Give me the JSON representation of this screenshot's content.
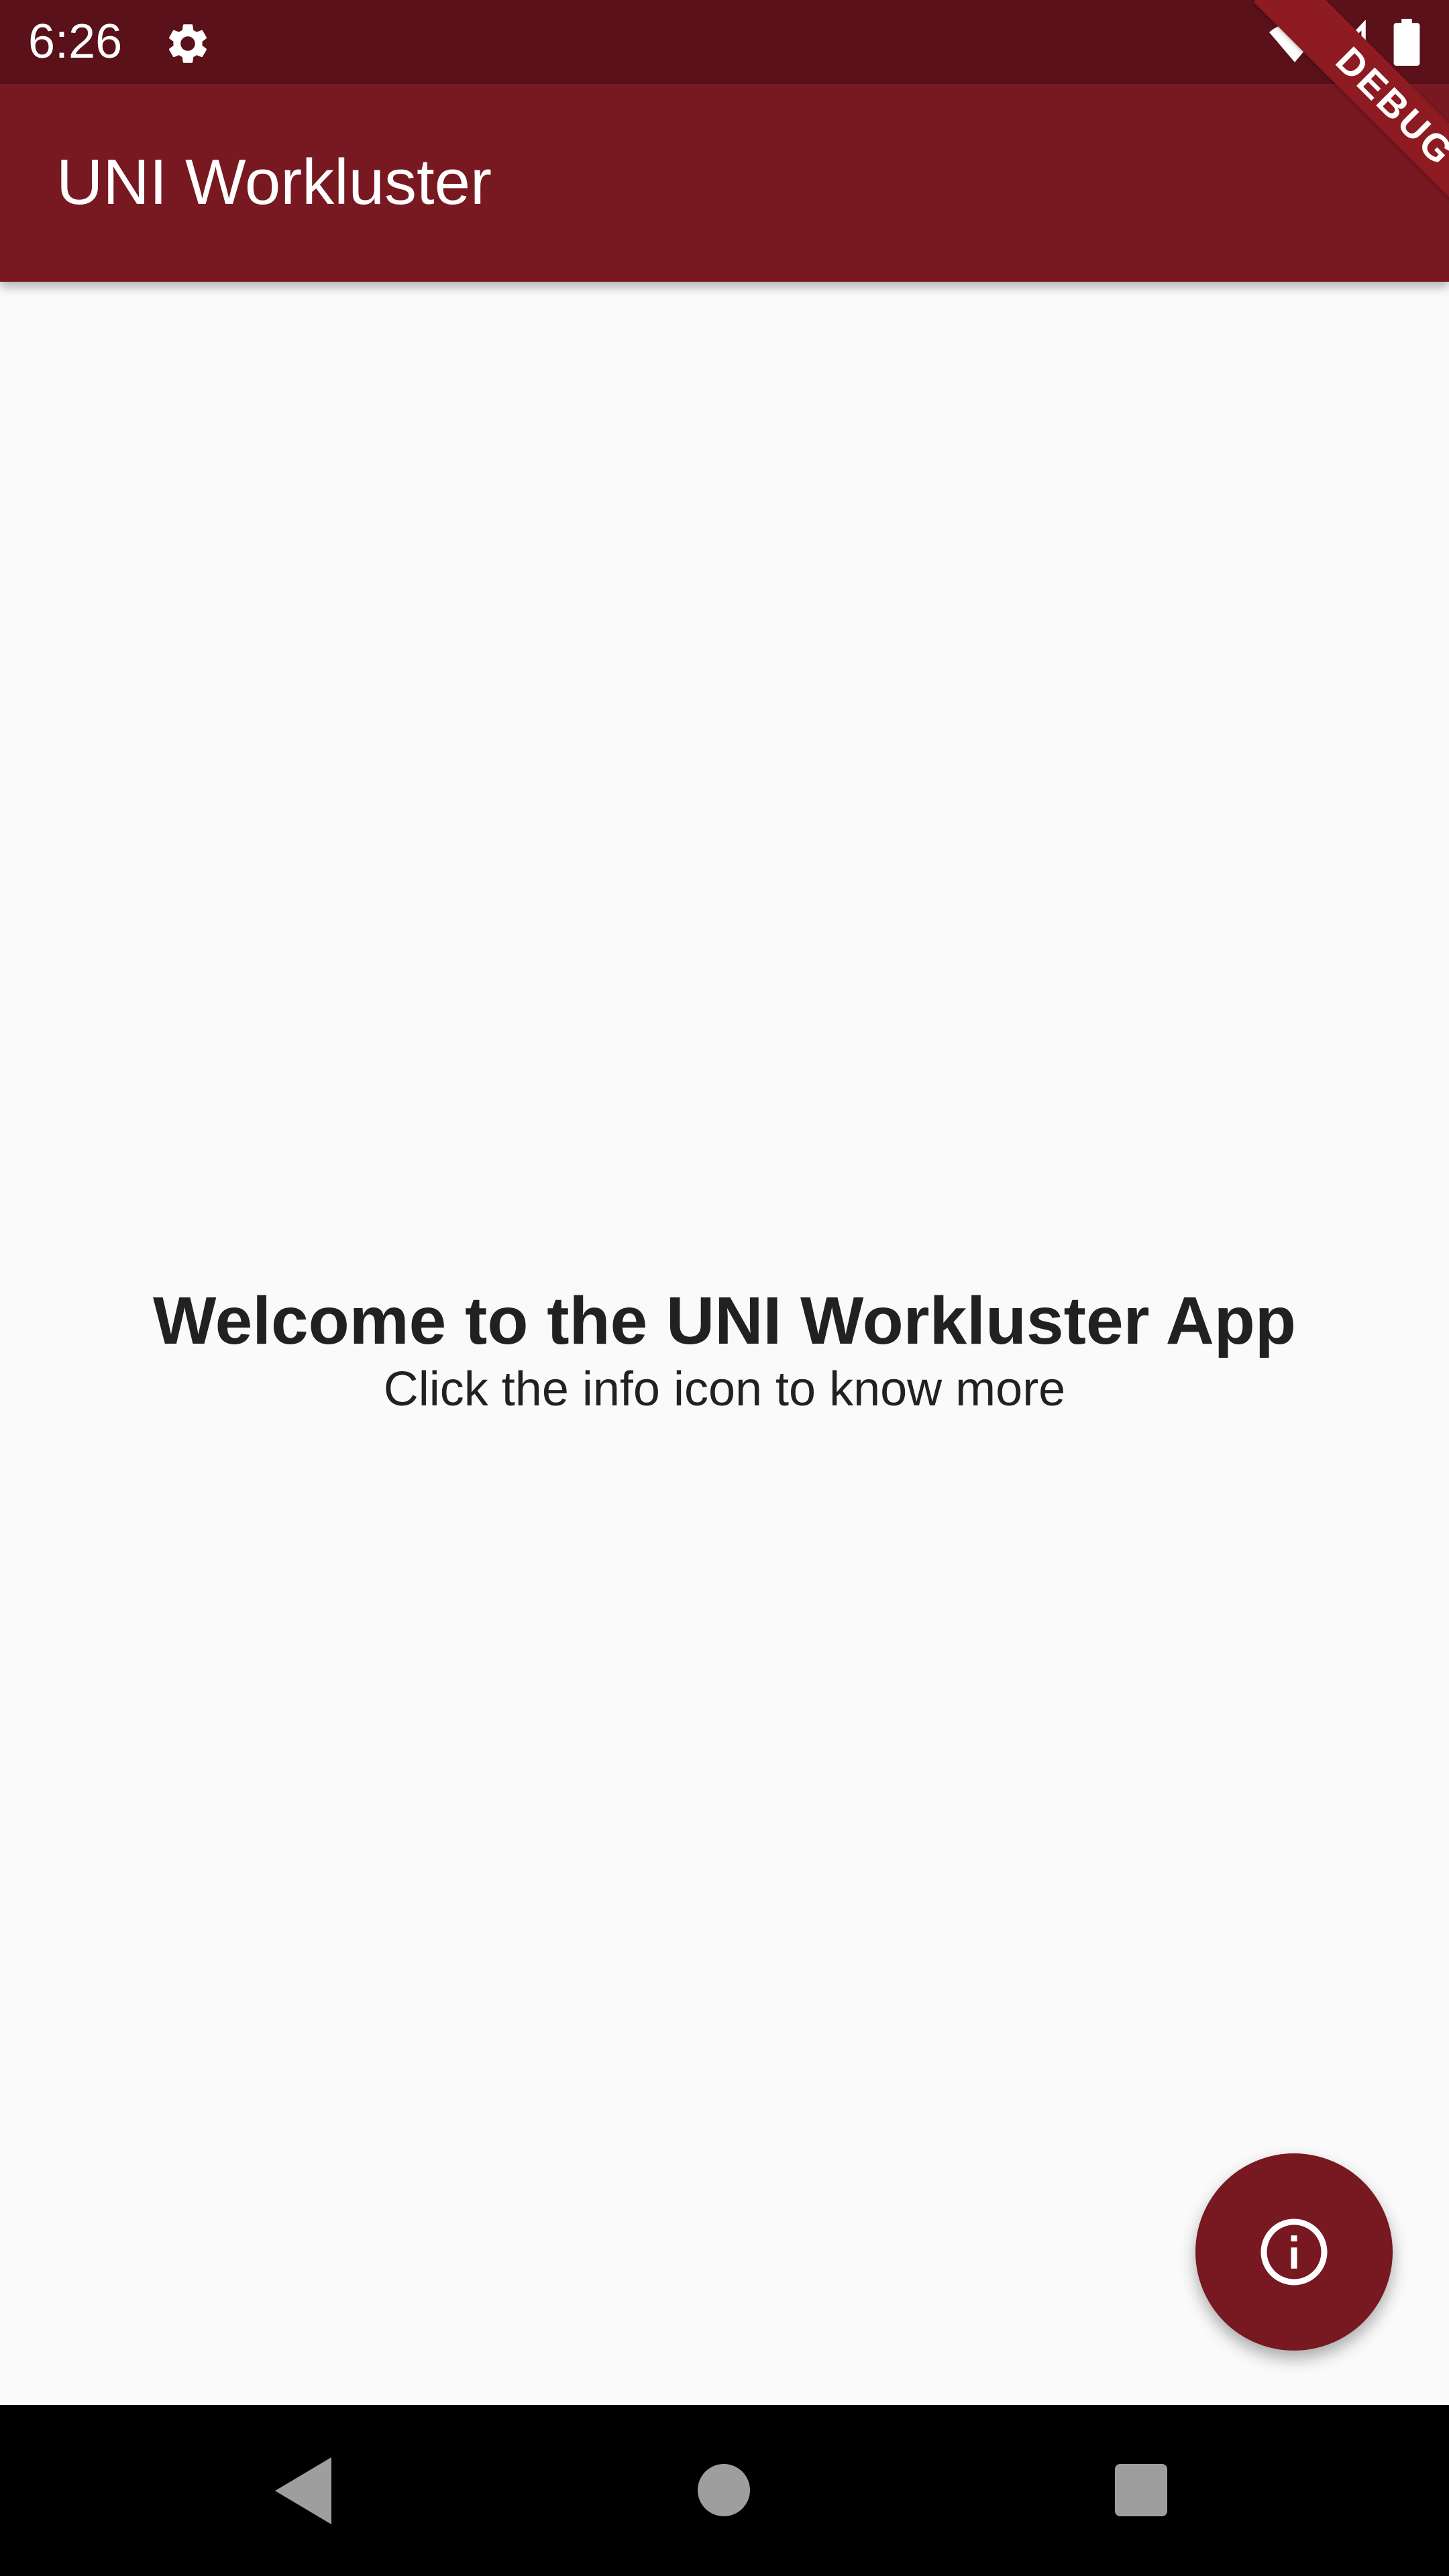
{
  "status_bar": {
    "time": "6:26",
    "icons": [
      "settings-icon",
      "wifi-icon",
      "signal-icon",
      "battery-icon"
    ]
  },
  "app_bar": {
    "title": "UNI Workluster"
  },
  "debug_banner": {
    "label": "DEBUG"
  },
  "main": {
    "welcome_title": "Welcome to the UNI Workluster App",
    "welcome_subtitle": "Click the info icon to know more"
  },
  "fab": {
    "icon": "info-icon"
  },
  "nav_bar": {
    "icons": [
      "back-icon",
      "home-icon",
      "recents-icon"
    ]
  },
  "colors": {
    "status_bar": "#5a1119",
    "app_bar": "#781821",
    "fab": "#781821",
    "debug_banner": "#8e1a22",
    "background": "#fafafa",
    "text": "#212121",
    "nav_bar": "#000000"
  }
}
